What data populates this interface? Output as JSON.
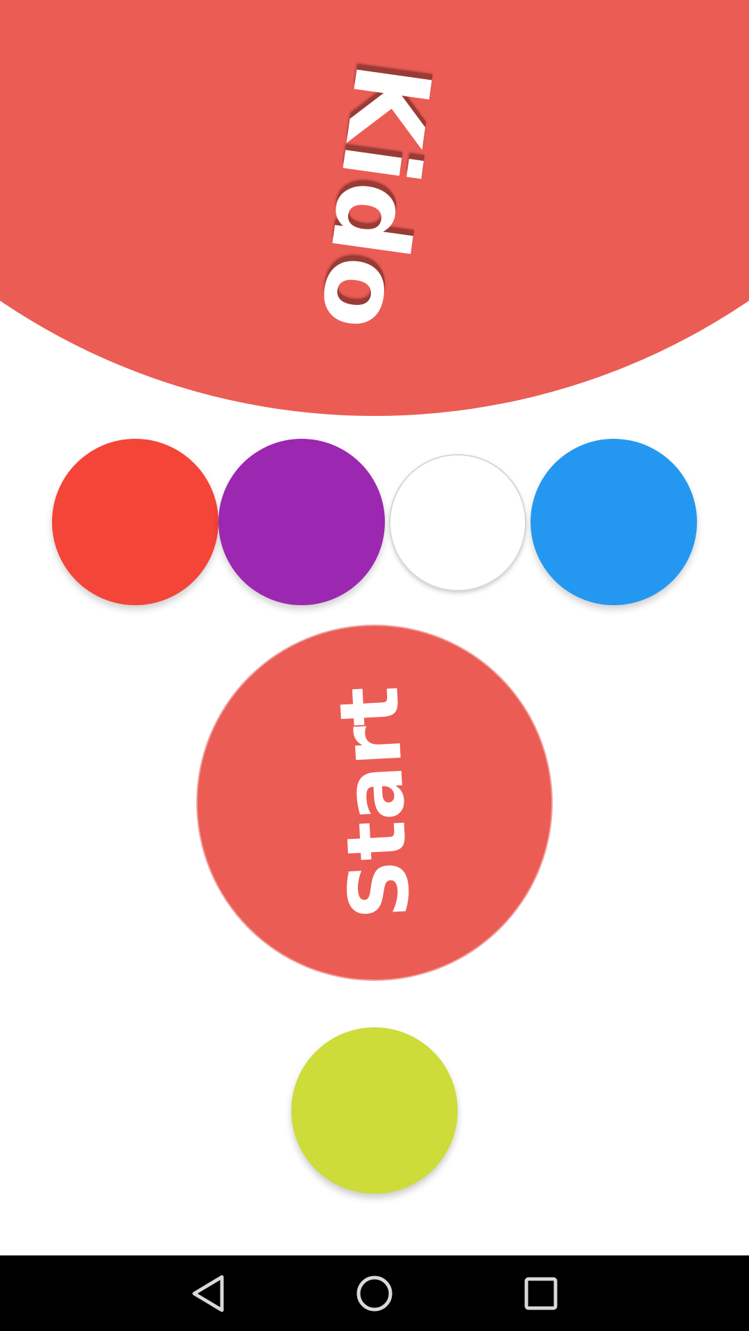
{
  "logo": {
    "text": "Kido"
  },
  "colors": {
    "header": "#eb5c55",
    "swatches": [
      "#f44538",
      "#9c27b0",
      "#ffffff",
      "#2498f1"
    ],
    "start": "#eb5c55",
    "lime": "#cddc39",
    "navbar": "#000000"
  },
  "start_button": {
    "label": "Start"
  },
  "swatches": [
    {
      "name": "red",
      "color": "#f44538"
    },
    {
      "name": "purple",
      "color": "#9c27b0"
    },
    {
      "name": "white",
      "color": "#ffffff",
      "selected": true
    },
    {
      "name": "blue",
      "color": "#2498f1"
    }
  ],
  "nav": {
    "back_icon": "back-triangle-icon",
    "home_icon": "home-circle-icon",
    "recents_icon": "recents-square-icon"
  }
}
